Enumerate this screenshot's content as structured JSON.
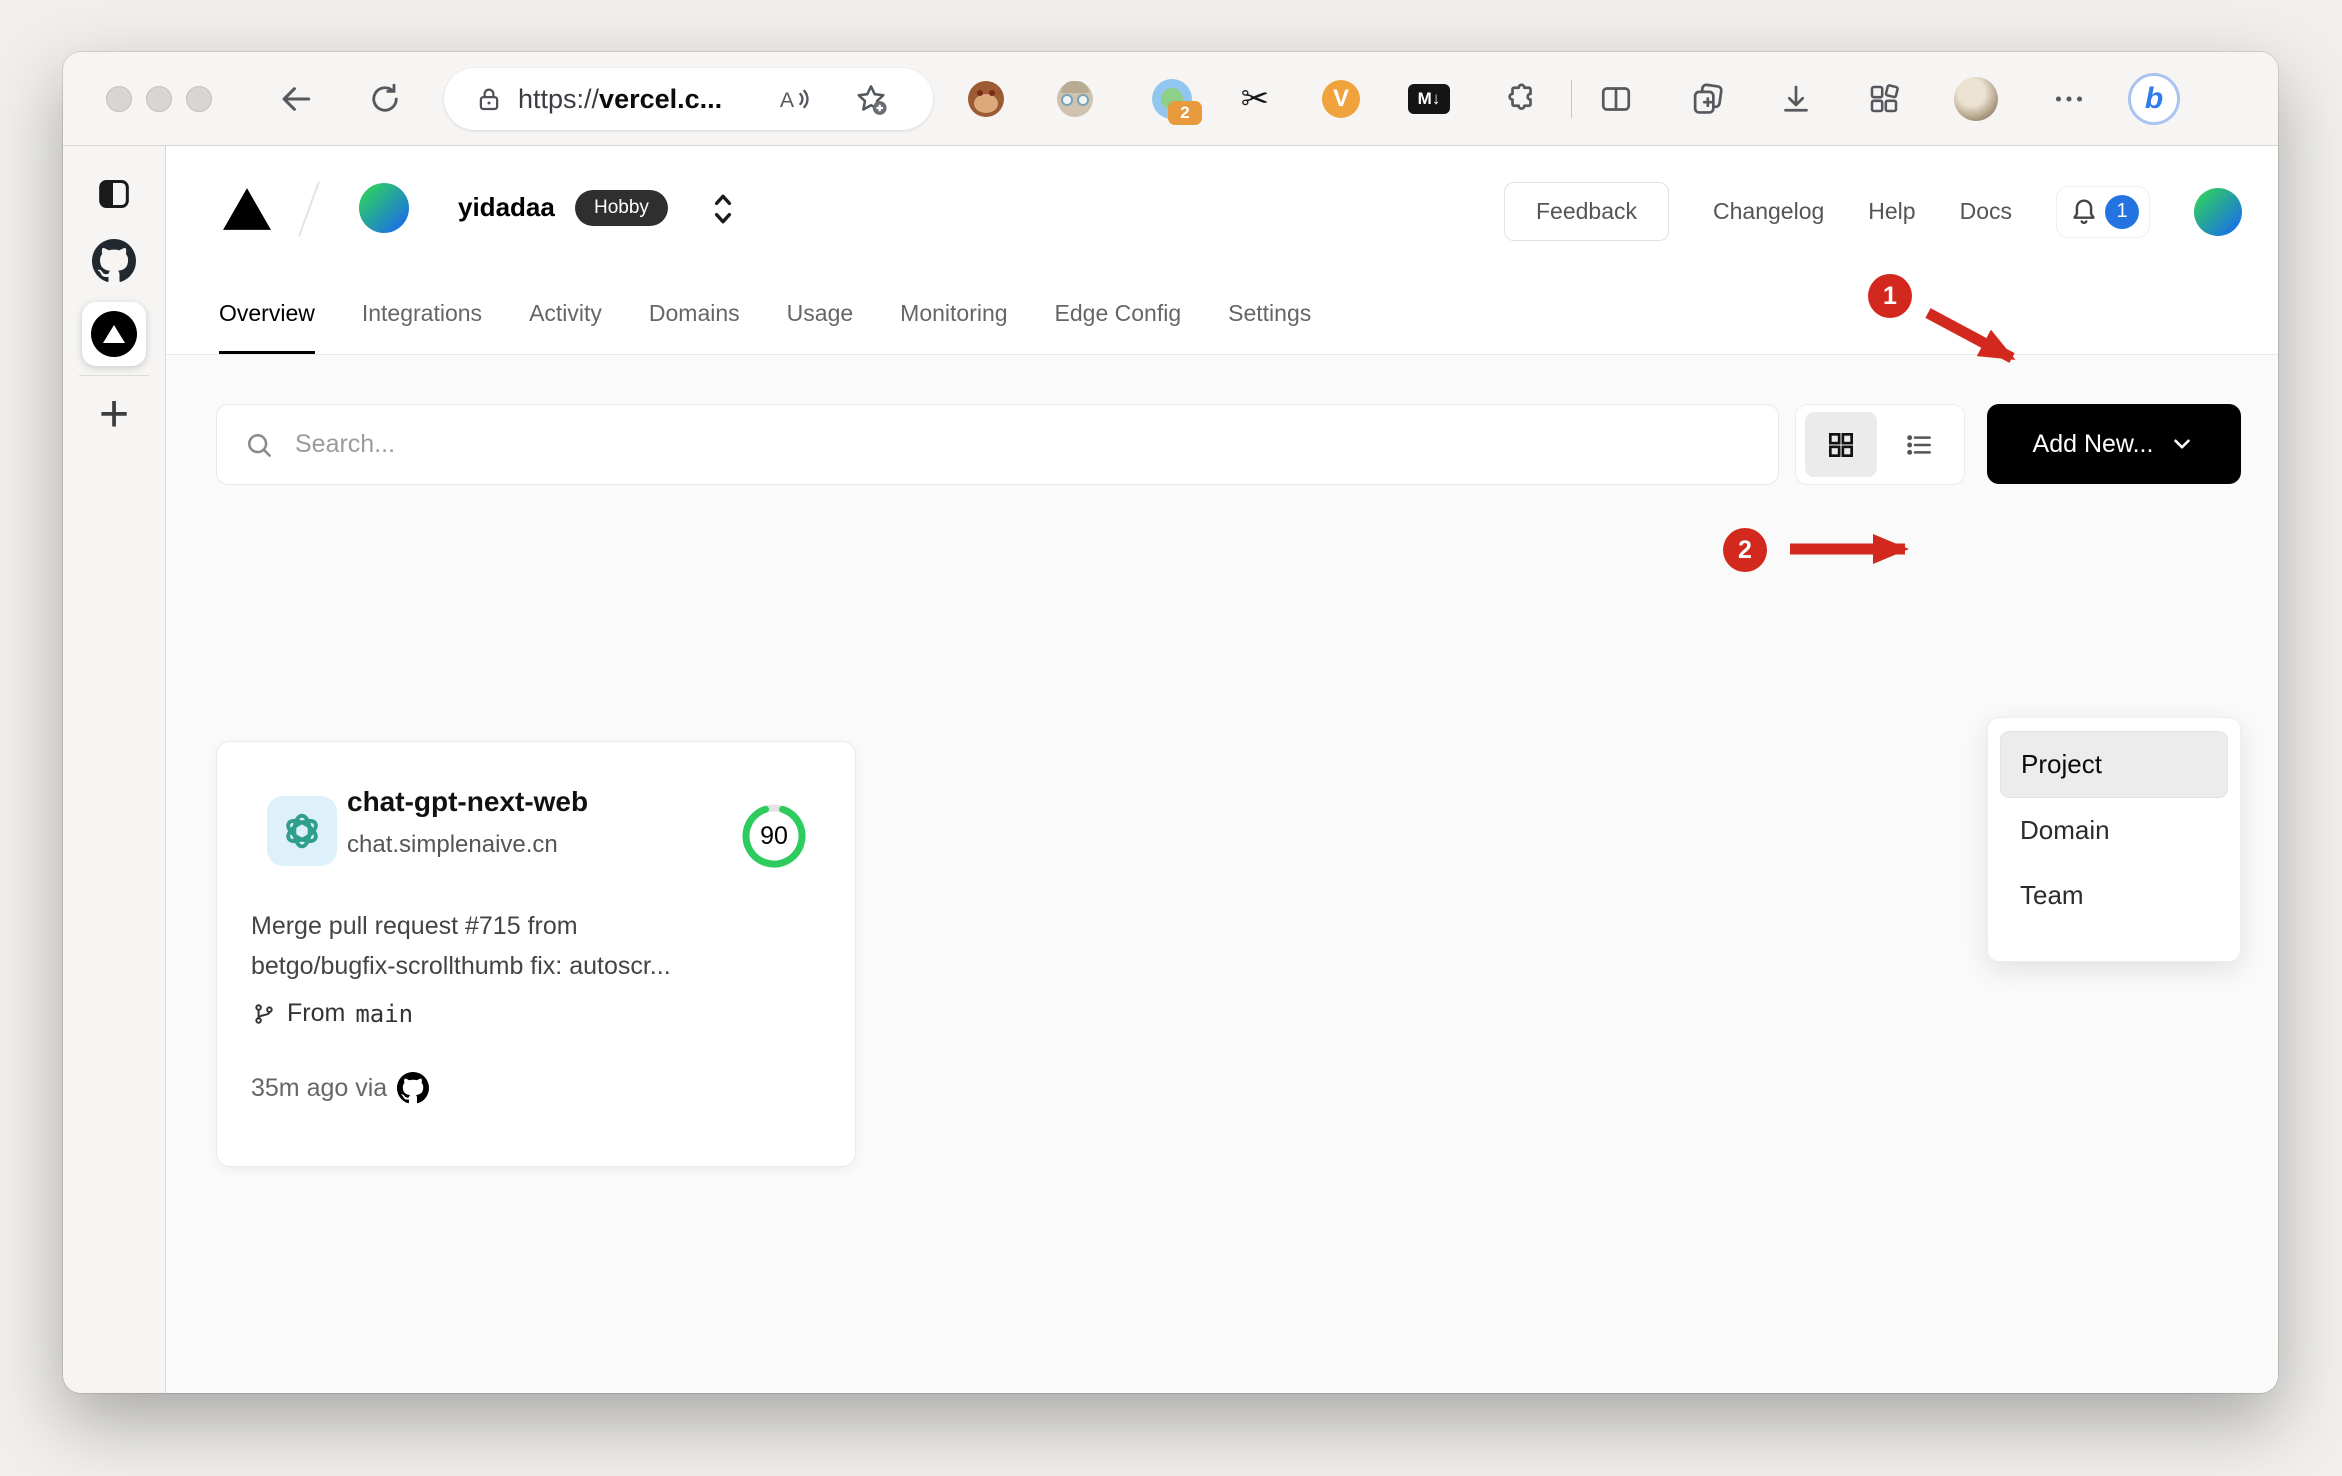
{
  "colors": {
    "annotation_red": "#d2281e",
    "score_green": "#2ecc5f",
    "notification_blue": "#2374e1",
    "brand_black": "#000000",
    "avatar_gradient_start": "#2fd05f",
    "avatar_gradient_end": "#1a6ee8",
    "openai_teal": "#2f9e8f"
  },
  "browser": {
    "url_scheme": "https://",
    "url_host": "vercel.c...",
    "ext_badge": "2",
    "ext_v": "V",
    "ext_md": "M↓",
    "bing": "b"
  },
  "vercel_header": {
    "team_name": "yidadaa",
    "plan_badge": "Hobby",
    "feedback": "Feedback",
    "changelog": "Changelog",
    "help": "Help",
    "docs": "Docs",
    "notifications": "1"
  },
  "tabs": {
    "items": [
      {
        "label": "Overview"
      },
      {
        "label": "Integrations"
      },
      {
        "label": "Activity"
      },
      {
        "label": "Domains"
      },
      {
        "label": "Usage"
      },
      {
        "label": "Monitoring"
      },
      {
        "label": "Edge Config"
      },
      {
        "label": "Settings"
      }
    ]
  },
  "controls": {
    "search_placeholder": "Search...",
    "add_new": "Add New..."
  },
  "dropdown": {
    "items": [
      {
        "label": "Project"
      },
      {
        "label": "Domain"
      },
      {
        "label": "Team"
      }
    ]
  },
  "card": {
    "name": "chat-gpt-next-web",
    "domain": "chat.simplenaive.cn",
    "score": "90",
    "commit_line1": "Merge pull request #715 from",
    "commit_line2": "betgo/bugfix-scrollthumb fix: autoscr...",
    "branch_label": "From",
    "branch_name": "main",
    "time": "35m ago via"
  },
  "annotations": {
    "step1": "1",
    "step2": "2"
  }
}
